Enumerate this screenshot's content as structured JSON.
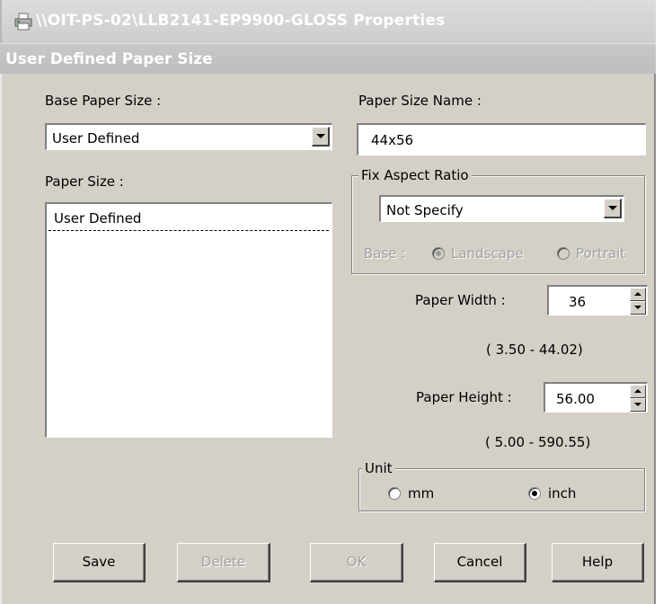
{
  "window": {
    "title": "\\\\OIT-PS-02\\LLB2141-EP9900-GLOSS Properties",
    "dialog_title": "User Defined Paper Size"
  },
  "base_paper_size": {
    "label": "Base Paper Size :",
    "selected": "User Defined"
  },
  "paper_size_name": {
    "label": "Paper Size Name :",
    "value": "44x56"
  },
  "paper_size": {
    "label": "Paper Size :",
    "items": [
      "User Defined"
    ]
  },
  "fix_aspect_ratio": {
    "legend": "Fix Aspect Ratio",
    "selected": "Not Specify",
    "base_label": "Base :",
    "landscape_label": "Landscape",
    "portrait_label": "Portrait",
    "selected_base": "Landscape"
  },
  "paper_width": {
    "label": "Paper Width  :",
    "value": "36",
    "range": "( 3.50 - 44.02)"
  },
  "paper_height": {
    "label": "Paper Height :",
    "value": "56.00",
    "range": "( 5.00 - 590.55)"
  },
  "unit": {
    "legend": "Unit",
    "mm_label": "mm",
    "inch_label": "inch",
    "selected": "inch"
  },
  "buttons": {
    "save": "Save",
    "delete": "Delete",
    "ok": "OK",
    "cancel": "Cancel",
    "help": "Help"
  },
  "colors": {
    "dialog_face": "#d4d0c8",
    "titlebar_inactive": "#cdcdcd",
    "disabled_text": "#a0a0a0"
  },
  "icons": {
    "title_icon": "printer-icon"
  }
}
